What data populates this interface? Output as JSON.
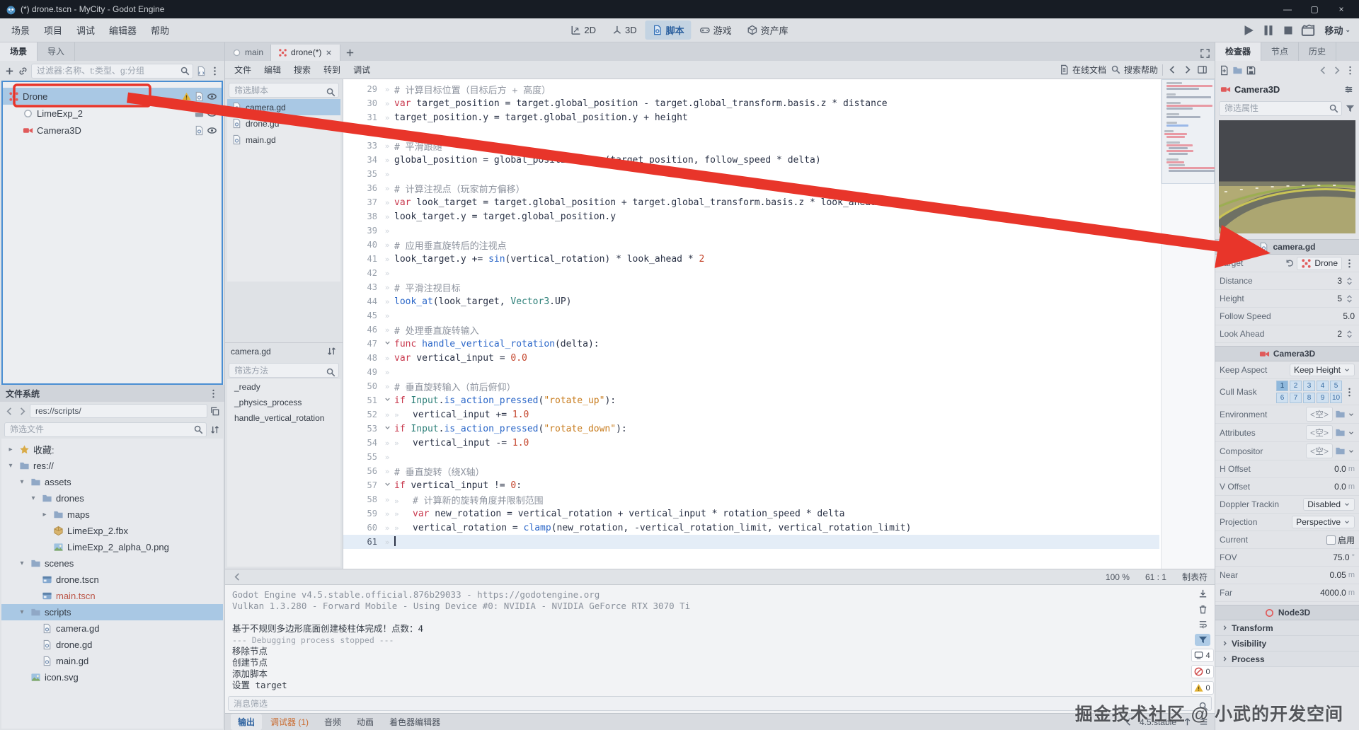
{
  "titlebar": {
    "title": "(*) drone.tscn - MyCity - Godot Engine"
  },
  "menubar": {
    "menus": [
      "场景",
      "项目",
      "调试",
      "编辑器",
      "帮助"
    ],
    "workspaces": [
      {
        "label": "2D",
        "icon": "ws2d",
        "active": false
      },
      {
        "label": "3D",
        "icon": "ws3d",
        "active": false
      },
      {
        "label": "脚本",
        "icon": "wsscript",
        "active": true
      },
      {
        "label": "游戏",
        "icon": "wsgame",
        "active": false
      },
      {
        "label": "资产库",
        "icon": "wsasset",
        "active": false
      }
    ],
    "renderer": "移动"
  },
  "scene_dock": {
    "tabs": [
      {
        "label": "场景",
        "active": true
      },
      {
        "label": "导入",
        "active": false
      }
    ],
    "filter_placeholder": "过滤器:名称、t:类型、g:分组",
    "nodes": [
      {
        "name": "Drone",
        "icon": "drone",
        "depth": 0,
        "selected": true,
        "badges": [
          "warn",
          "script",
          "eye"
        ]
      },
      {
        "name": "LimeExp_2",
        "icon": "node3d",
        "depth": 1,
        "selected": false,
        "badges": [
          "instance",
          "eye"
        ]
      },
      {
        "name": "Camera3D",
        "icon": "camera",
        "depth": 1,
        "selected": false,
        "badges": [
          "script",
          "eye"
        ]
      }
    ]
  },
  "filesystem": {
    "title": "文件系统",
    "path": "res://scripts/",
    "filter_placeholder": "筛选文件",
    "tree": [
      {
        "label": "收藏:",
        "depth": 0,
        "icon": "star",
        "arrow": "closed"
      },
      {
        "label": "res://",
        "depth": 0,
        "icon": "folder",
        "arrow": "open"
      },
      {
        "label": "assets",
        "depth": 1,
        "icon": "folder",
        "arrow": "open"
      },
      {
        "label": "drones",
        "depth": 2,
        "icon": "folder",
        "arrow": "open"
      },
      {
        "label": "maps",
        "depth": 3,
        "icon": "folder",
        "arrow": "closed"
      },
      {
        "label": "LimeExp_2.fbx",
        "depth": 3,
        "icon": "mesh",
        "arrow": "none"
      },
      {
        "label": "LimeExp_2_alpha_0.png",
        "depth": 3,
        "icon": "image",
        "arrow": "none"
      },
      {
        "label": "scenes",
        "depth": 1,
        "icon": "folder",
        "arrow": "open"
      },
      {
        "label": "drone.tscn",
        "depth": 2,
        "icon": "scene",
        "arrow": "none"
      },
      {
        "label": "main.tscn",
        "depth": 2,
        "icon": "scene",
        "arrow": "none",
        "main": true
      },
      {
        "label": "scripts",
        "depth": 1,
        "icon": "folder",
        "arrow": "open",
        "selected": true
      },
      {
        "label": "camera.gd",
        "depth": 2,
        "icon": "script",
        "arrow": "none"
      },
      {
        "label": "drone.gd",
        "depth": 2,
        "icon": "script",
        "arrow": "none"
      },
      {
        "label": "main.gd",
        "depth": 2,
        "icon": "script",
        "arrow": "none"
      },
      {
        "label": "icon.svg",
        "depth": 1,
        "icon": "image",
        "arrow": "none"
      }
    ]
  },
  "scene_tabs": [
    {
      "label": "main",
      "icon": "node3d",
      "active": false,
      "closable": false
    },
    {
      "label": "drone(*)",
      "icon": "drone",
      "active": true,
      "closable": true
    }
  ],
  "script_editor": {
    "menu": [
      "文件",
      "编辑",
      "搜索",
      "转到",
      "调试"
    ],
    "online_docs": "在线文档",
    "search_help": "搜索帮助",
    "filter_scripts_placeholder": "筛选脚本",
    "scripts": [
      {
        "name": "camera.gd",
        "selected": true
      },
      {
        "name": "drone.gd",
        "selected": false
      },
      {
        "name": "main.gd",
        "selected": false
      }
    ],
    "current_script": "camera.gd",
    "filter_methods_placeholder": "筛选方法",
    "methods": [
      "_ready",
      "_physics_process",
      "handle_vertical_rotation"
    ],
    "status": {
      "zoom": "100 %",
      "cursor": "61 : 1",
      "indent": "制表符"
    },
    "lines": [
      {
        "n": 29,
        "i": 1,
        "tk": [
          [
            "c",
            "# 计算目标位置（目标后方 + 高度）"
          ]
        ]
      },
      {
        "n": 30,
        "i": 1,
        "tk": [
          [
            "k",
            "var"
          ],
          [
            "t",
            " target_position = target.global_position - target.global_transform.basis.z * distance"
          ]
        ]
      },
      {
        "n": 31,
        "i": 1,
        "tk": [
          [
            "t",
            "target_position.y = target.global_position.y + height"
          ]
        ]
      },
      {
        "n": 32,
        "i": 1,
        "tk": []
      },
      {
        "n": 33,
        "i": 1,
        "tk": [
          [
            "c",
            "# 平滑跟随"
          ]
        ]
      },
      {
        "n": 34,
        "i": 1,
        "tk": [
          [
            "t",
            "global_position = global_position."
          ],
          [
            "f",
            "lerp"
          ],
          [
            "t",
            "(target_position, follow_speed * delta)"
          ]
        ]
      },
      {
        "n": 35,
        "i": 1,
        "tk": []
      },
      {
        "n": 36,
        "i": 1,
        "tk": [
          [
            "c",
            "# 计算注视点（玩家前方偏移）"
          ]
        ]
      },
      {
        "n": 37,
        "i": 1,
        "tk": [
          [
            "k",
            "var"
          ],
          [
            "t",
            " look_target = target.global_position + target.global_transform.basis.z * look_ahead"
          ]
        ]
      },
      {
        "n": 38,
        "i": 1,
        "tk": [
          [
            "t",
            "look_target.y = target.global_position.y"
          ]
        ]
      },
      {
        "n": 39,
        "i": 1,
        "tk": []
      },
      {
        "n": 40,
        "i": 1,
        "tk": [
          [
            "c",
            "# 应用垂直旋转后的注视点"
          ]
        ]
      },
      {
        "n": 41,
        "i": 1,
        "tk": [
          [
            "t",
            "look_target.y += "
          ],
          [
            "f",
            "sin"
          ],
          [
            "t",
            "(vertical_rotation) * look_ahead * "
          ],
          [
            "n2",
            "2"
          ]
        ]
      },
      {
        "n": 42,
        "i": 1,
        "tk": []
      },
      {
        "n": 43,
        "i": 1,
        "tk": [
          [
            "c",
            "# 平滑注视目标"
          ]
        ]
      },
      {
        "n": 44,
        "i": 1,
        "tk": [
          [
            "f",
            "look_at"
          ],
          [
            "t",
            "(look_target, "
          ],
          [
            "cl",
            "Vector3"
          ],
          [
            "t",
            ".UP)"
          ]
        ]
      },
      {
        "n": 45,
        "i": 1,
        "tk": []
      },
      {
        "n": 46,
        "i": 0,
        "tk": [
          [
            "c",
            "# 处理垂直旋转输入"
          ]
        ]
      },
      {
        "n": 47,
        "i": 0,
        "fold": true,
        "tk": [
          [
            "k",
            "func"
          ],
          [
            "t",
            " "
          ],
          [
            "f",
            "handle_vertical_rotation"
          ],
          [
            "t",
            "(delta):"
          ]
        ]
      },
      {
        "n": 48,
        "i": 1,
        "tk": [
          [
            "k",
            "var"
          ],
          [
            "t",
            " vertical_input = "
          ],
          [
            "n2",
            "0.0"
          ]
        ]
      },
      {
        "n": 49,
        "i": 1,
        "tk": []
      },
      {
        "n": 50,
        "i": 1,
        "tk": [
          [
            "c",
            "# 垂直旋转输入（前后俯仰）"
          ]
        ]
      },
      {
        "n": 51,
        "i": 1,
        "fold": true,
        "tk": [
          [
            "k",
            "if"
          ],
          [
            "t",
            " "
          ],
          [
            "cl",
            "Input"
          ],
          [
            "t",
            "."
          ],
          [
            "f",
            "is_action_pressed"
          ],
          [
            "t",
            "("
          ],
          [
            "s",
            "\"rotate_up\""
          ],
          [
            "t",
            "):"
          ]
        ]
      },
      {
        "n": 52,
        "i": 2,
        "tk": [
          [
            "t",
            "vertical_input += "
          ],
          [
            "n2",
            "1.0"
          ]
        ]
      },
      {
        "n": 53,
        "i": 1,
        "fold": true,
        "tk": [
          [
            "k",
            "if"
          ],
          [
            "t",
            " "
          ],
          [
            "cl",
            "Input"
          ],
          [
            "t",
            "."
          ],
          [
            "f",
            "is_action_pressed"
          ],
          [
            "t",
            "("
          ],
          [
            "s",
            "\"rotate_down\""
          ],
          [
            "t",
            "):"
          ]
        ]
      },
      {
        "n": 54,
        "i": 2,
        "tk": [
          [
            "t",
            "vertical_input -= "
          ],
          [
            "n2",
            "1.0"
          ]
        ]
      },
      {
        "n": 55,
        "i": 1,
        "tk": []
      },
      {
        "n": 56,
        "i": 1,
        "tk": [
          [
            "c",
            "# 垂直旋转（绕X轴）"
          ]
        ]
      },
      {
        "n": 57,
        "i": 1,
        "fold": true,
        "tk": [
          [
            "k",
            "if"
          ],
          [
            "t",
            " vertical_input != "
          ],
          [
            "n2",
            "0"
          ],
          [
            "t",
            ":"
          ]
        ]
      },
      {
        "n": 58,
        "i": 2,
        "tk": [
          [
            "c",
            "# 计算新的旋转角度并限制范围"
          ]
        ]
      },
      {
        "n": 59,
        "i": 2,
        "tk": [
          [
            "k",
            "var"
          ],
          [
            "t",
            " new_rotation = vertical_rotation + vertical_input * rotation_speed * delta"
          ]
        ]
      },
      {
        "n": 60,
        "i": 2,
        "tk": [
          [
            "t",
            "vertical_rotation = "
          ],
          [
            "f",
            "clamp"
          ],
          [
            "t",
            "(new_rotation, -vertical_rotation_limit, vertical_rotation_limit)"
          ]
        ]
      },
      {
        "n": 61,
        "i": 0,
        "cur": true,
        "tk": []
      }
    ]
  },
  "output": {
    "lines": [
      {
        "kind": "meta",
        "text": "Godot Engine v4.5.stable.official.876b29033 - https://godotengine.org"
      },
      {
        "kind": "meta",
        "text": "Vulkan 1.3.280 - Forward Mobile - Using Device #0: NVIDIA - NVIDIA GeForce RTX 3070 Ti"
      },
      {
        "kind": "meta",
        "text": ""
      },
      {
        "kind": "normal",
        "text": "基于不规则多边形底面创建棱柱体完成！点数：4"
      },
      {
        "kind": "debug",
        "text": "--- Debugging process stopped ---"
      },
      {
        "kind": "normal",
        "text": "移除节点"
      },
      {
        "kind": "normal",
        "text": "创建节点"
      },
      {
        "kind": "normal",
        "text": "添加脚本"
      },
      {
        "kind": "normal",
        "text": "设置 target"
      }
    ],
    "filter_placeholder": "消息筛选",
    "counters": {
      "info": "4",
      "errors": "0",
      "warnings": "0"
    }
  },
  "bottom_bar": {
    "tabs": [
      {
        "label": "输出",
        "active": true,
        "warn": false
      },
      {
        "label": "调试器 (1)",
        "active": false,
        "warn": true
      },
      {
        "label": "音频",
        "active": false,
        "warn": false
      },
      {
        "label": "动画",
        "active": false,
        "warn": false
      },
      {
        "label": "着色器编辑器",
        "active": false,
        "warn": false
      }
    ],
    "version": "4.5.stable"
  },
  "inspector": {
    "tabs": [
      {
        "label": "检查器",
        "active": true
      },
      {
        "label": "节点",
        "active": false
      },
      {
        "label": "历史",
        "active": false
      }
    ],
    "node_name": "Camera3D",
    "filter_placeholder": "筛选属性",
    "script_section": "camera.gd",
    "script_props": [
      {
        "label": "Target",
        "value": "Drone",
        "type": "node"
      },
      {
        "label": "Distance",
        "value": "3",
        "type": "spin"
      },
      {
        "label": "Height",
        "value": "5",
        "type": "spin"
      },
      {
        "label": "Follow Speed",
        "value": "5.0",
        "type": "plain"
      },
      {
        "label": "Look Ahead",
        "value": "2",
        "type": "spin"
      }
    ],
    "camera_section": "Camera3D",
    "camera_props": [
      {
        "label": "Keep Aspect",
        "value": "Keep Height",
        "type": "dropdown"
      },
      {
        "label": "Cull Mask",
        "type": "mask"
      },
      {
        "label": "Environment",
        "value": "<空>",
        "type": "resource"
      },
      {
        "label": "Attributes",
        "value": "<空>",
        "type": "resource"
      },
      {
        "label": "Compositor",
        "value": "<空>",
        "type": "resource"
      },
      {
        "label": "H Offset",
        "value": "0.0",
        "unit": "m",
        "type": "unit"
      },
      {
        "label": "V Offset",
        "value": "0.0",
        "unit": "m",
        "type": "unit"
      },
      {
        "label": "Doppler Trackin",
        "value": "Disabled",
        "type": "dropdown"
      },
      {
        "label": "Projection",
        "value": "Perspective",
        "type": "dropdown"
      },
      {
        "label": "Current",
        "value": "启用",
        "type": "check"
      },
      {
        "label": "FOV",
        "value": "75.0",
        "unit": "°",
        "type": "unit"
      },
      {
        "label": "Near",
        "value": "0.05",
        "unit": "m",
        "type": "unit"
      },
      {
        "label": "Far",
        "value": "4000.0",
        "unit": "m",
        "type": "unit"
      }
    ],
    "cull_mask_cells": [
      "1",
      "2",
      "3",
      "4",
      "5",
      "6",
      "7",
      "8",
      "9",
      "10"
    ],
    "cull_mask_active": [
      "1"
    ],
    "node3d_section": "Node3D",
    "groups": [
      "Transform",
      "Visibility",
      "Process"
    ]
  },
  "annotation": {
    "arrow_color": "#e8352a"
  },
  "watermark": "掘金技术社区 @ 小武的开发空间"
}
